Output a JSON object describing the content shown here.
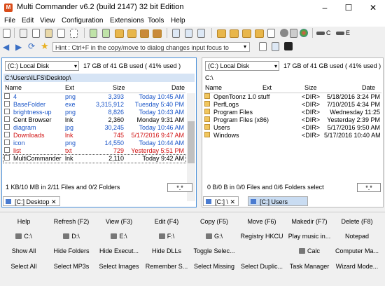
{
  "window": {
    "title": "Multi Commander v6.2 (build 2147) 32 bit Edition",
    "minimize": "–",
    "maximize": "☐",
    "close": "✕"
  },
  "menu": [
    "File",
    "Edit",
    "View",
    "Configuration",
    "Extensions",
    "Tools",
    "Help"
  ],
  "toolbar": {
    "drive_c": "C",
    "drive_e": "E"
  },
  "hint": "Hint : Ctrl+F in the copy/move to dialog changes input focus to",
  "left": {
    "drive": "(C:) Local Disk",
    "free": "17 GB of 41 GB used ( 41% used )",
    "path": "C:\\Users\\ILFS\\Desktop\\",
    "headers": [
      "Name",
      "Ext",
      "Size",
      "Date"
    ],
    "rows": [
      {
        "name": "4",
        "ext": "png",
        "size": "3,393",
        "date": "Today 10:45 AM",
        "color": "blue",
        "icon": "file"
      },
      {
        "name": "BaseFolder",
        "ext": "exe",
        "size": "3,315,912",
        "date": "Tuesday 5:40 PM",
        "color": "blue",
        "icon": "file"
      },
      {
        "name": "brightness-up",
        "ext": "png",
        "size": "8,826",
        "date": "Today 10:43 AM",
        "color": "blue",
        "icon": "file"
      },
      {
        "name": "Cent Browser",
        "ext": "lnk",
        "size": "2,360",
        "date": "Monday 9:31 AM",
        "color": "black",
        "icon": "file"
      },
      {
        "name": "diagram",
        "ext": "jpg",
        "size": "30,245",
        "date": "Today 10:46 AM",
        "color": "blue",
        "icon": "file"
      },
      {
        "name": "Downloads",
        "ext": "lnk",
        "size": "745",
        "date": "5/17/2016 9:47 AM",
        "color": "red",
        "icon": "file"
      },
      {
        "name": "icon",
        "ext": "png",
        "size": "14,550",
        "date": "Today 10:44 AM",
        "color": "blue",
        "icon": "file"
      },
      {
        "name": "list",
        "ext": "txt",
        "size": "729",
        "date": "Yesterday 5:51 PM",
        "color": "red",
        "icon": "file"
      },
      {
        "name": "MultiCommander",
        "ext": "lnk",
        "size": "2,110",
        "date": "Today 9:42 AM",
        "color": "black",
        "icon": "file"
      }
    ],
    "status": "1 KB/10 MB in 2/11 Files and 0/2 Folders",
    "filter": "*.*",
    "tab": "[C:] Desktop"
  },
  "right": {
    "drive": "(C:) Local Disk",
    "free": "17 GB of 41 GB used ( 41% used )",
    "path": "C:\\",
    "headers": [
      "Name",
      "Ext",
      "Size",
      "Date"
    ],
    "rows": [
      {
        "name": "OpenToonz 1.0 stuff",
        "size": "<DIR>",
        "date": "5/18/2016 3:24 PM"
      },
      {
        "name": "PerfLogs",
        "size": "<DIR>",
        "date": "7/10/2015 4:34 PM"
      },
      {
        "name": "Program Files",
        "size": "<DIR>",
        "date": "Wednesday 11:25"
      },
      {
        "name": "Program Files (x86)",
        "size": "<DIR>",
        "date": "Yesterday 2:39 PM"
      },
      {
        "name": "Users",
        "size": "<DIR>",
        "date": "5/17/2016 9:50 AM"
      },
      {
        "name": "Windows",
        "size": "<DIR>",
        "date": "5/17/2016 10:40 AM"
      }
    ],
    "status": "0 B/0 B in 0/0 Files and 0/6 Folders select",
    "filter": "*.*",
    "tab1": "[C:] \\",
    "tab2": "[C:] Users"
  },
  "buttons": [
    [
      "Help",
      "Refresh (F2)",
      "View (F3)",
      "Edit (F4)",
      "Copy (F5)",
      "Move (F6)",
      "Makedir (F7)",
      "Delete (F8)"
    ],
    [
      "C:\\",
      "D:\\",
      "E:\\",
      "F:\\",
      "G:\\",
      "Registry HKCU",
      "Play music in...",
      "Notepad"
    ],
    [
      "Show All",
      "Hide Folders",
      "Hide Execut...",
      "Hide DLLs",
      "Toggle Selec...",
      "",
      "Calc",
      "Computer Ma..."
    ],
    [
      "Select All",
      "Select MP3s",
      "Select Images",
      "Remember S...",
      "Select Missing",
      "Select Duplic...",
      "Task Manager",
      "Wizard Mode..."
    ]
  ]
}
